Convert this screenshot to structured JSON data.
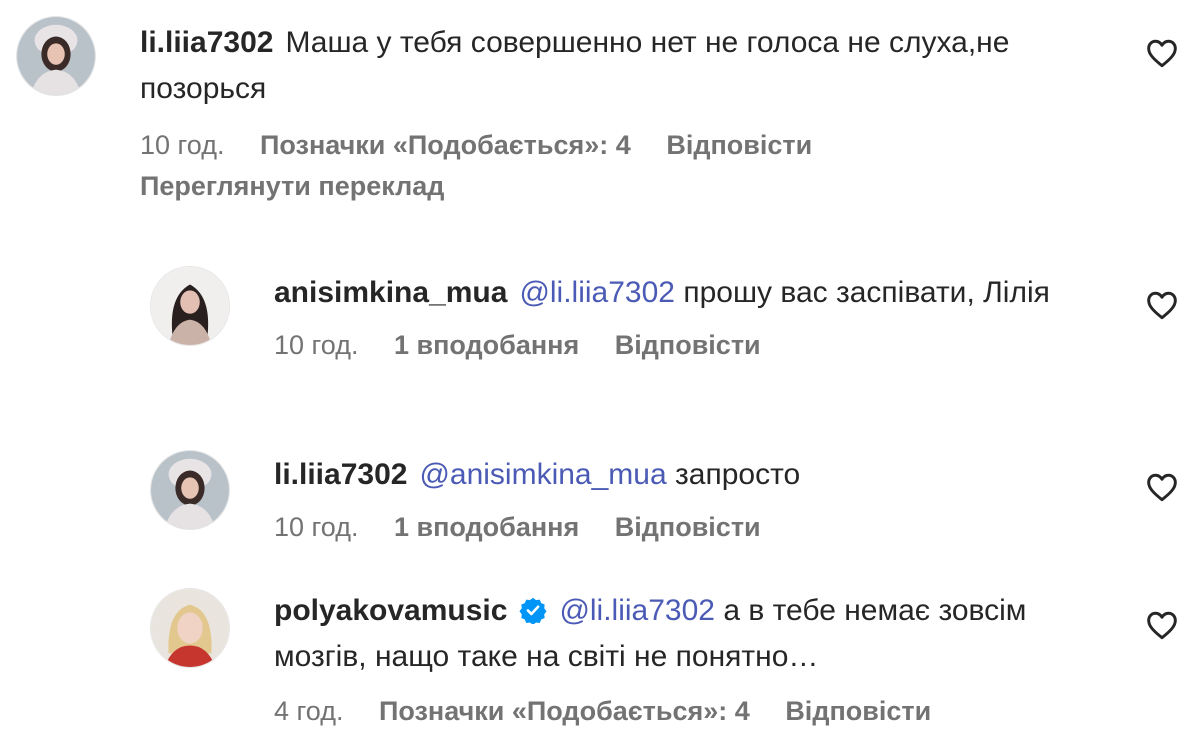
{
  "comments": [
    {
      "username": "li.liia7302",
      "text": "Маша у тебя совершенно нет не голоса не слуха,не позорься",
      "time": "10 год.",
      "likes": "Позначки «Подобається»: 4",
      "reply": "Відповісти",
      "translate": "Переглянути переклад"
    },
    {
      "username": "anisimkina_mua",
      "mention": "@li.liia7302",
      "text": "прошу вас заспівати, Лілія",
      "time": "10 год.",
      "likes": "1 вподобання",
      "reply": "Відповісти"
    },
    {
      "username": "li.liia7302",
      "mention": "@anisimkina_mua",
      "text": "запросто",
      "time": "10 год.",
      "likes": "1 вподобання",
      "reply": "Відповісти"
    },
    {
      "username": "polyakovamusic",
      "mention": "@li.liia7302",
      "text": "а в тебе немає зовсім мозгів, нащо таке на світі не понятно…",
      "time": "4 год.",
      "likes": "Позначки «Подобається»: 4",
      "reply": "Відповісти"
    }
  ],
  "colors": {
    "text": "#262626",
    "secondary": "#737373",
    "mention": "#4b5bb5",
    "verified": "#0095f6"
  },
  "icons": [
    "heart-outline-icon",
    "verified-badge-icon",
    "avatar"
  ]
}
